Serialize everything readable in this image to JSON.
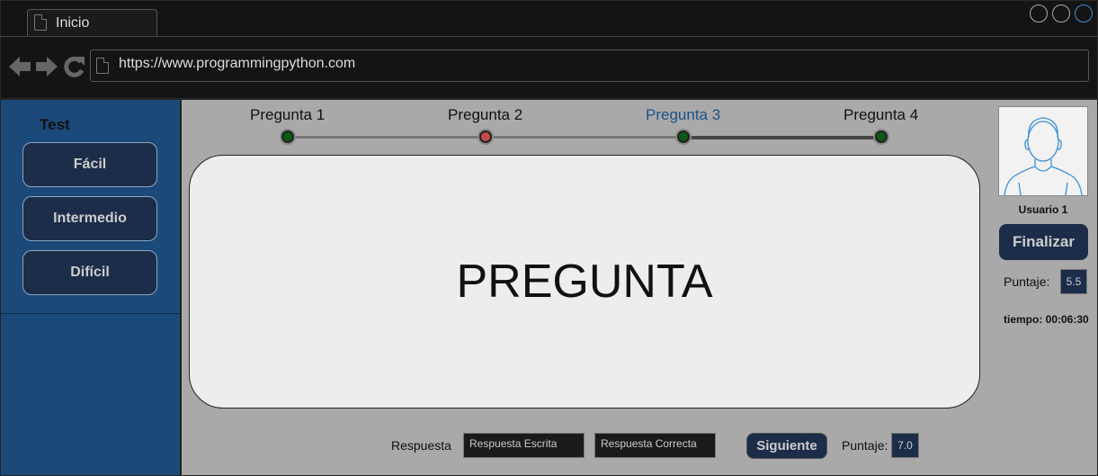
{
  "browser": {
    "tab_title": "Inicio",
    "url": "https://www.programmingpython.com"
  },
  "sidebar": {
    "title": "Test",
    "items": [
      {
        "label": "Fácil"
      },
      {
        "label": "Intermedio"
      },
      {
        "label": "Difícil"
      }
    ]
  },
  "progress": {
    "steps": [
      {
        "label": "Pregunta 1",
        "status": "correct",
        "color": "#0a5a14"
      },
      {
        "label": "Pregunta 2",
        "status": "incorrect",
        "color": "#c24a4a"
      },
      {
        "label": "Pregunta 3",
        "status": "current",
        "color": "#0a5a14"
      },
      {
        "label": "Pregunta 4",
        "status": "pending",
        "color": "#0a5a14"
      }
    ]
  },
  "question": {
    "text": "PREGUNTA"
  },
  "user": {
    "name": "Usuario 1",
    "finish_label": "Finalizar",
    "score_label": "Puntaje:",
    "score_value": "5.5",
    "time_text": "tiempo: 00:06:30"
  },
  "answer": {
    "label": "Respuesta",
    "written_value": "Respuesta Escrita",
    "correct_value": "Respuesta Correcta",
    "next_label": "Siguiente",
    "score_label": "Puntaje:",
    "score_value": "7.0"
  },
  "colors": {
    "sidebar_bg": "#1b4a7a",
    "button_bg": "#1c2d4a",
    "accent": "#1d4f86"
  }
}
